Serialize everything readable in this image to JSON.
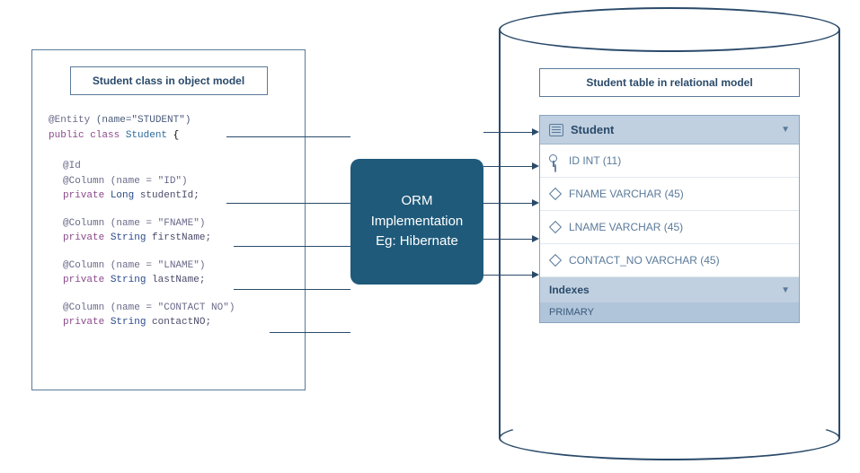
{
  "left": {
    "title": "Student class in object model",
    "code": {
      "entity_prefix": "@Entity ",
      "entity_name": "(name=\"STUDENT\")",
      "public_class": "public class ",
      "class_name": "Student",
      "brace": " {",
      "id_anno": "@Id",
      "col0": "@Column (name = \"ID\")",
      "priv": "private ",
      "type_long": "Long ",
      "field0": "studentId;",
      "col1": "@Column (name = \"FNAME\")",
      "type_string": "String ",
      "field1": "firstName;",
      "col2": "@Column (name = \"LNAME\")",
      "field2": "lastName;",
      "col3": "@Column (name = \"CONTACT NO\")",
      "field3": "contactNO;"
    }
  },
  "orm": {
    "line1": "ORM",
    "line2": "Implementation",
    "line3": "Eg: Hibernate"
  },
  "right": {
    "title": "Student table in relational model",
    "table_name": "Student",
    "cols": {
      "c0": "ID INT (11)",
      "c1": "FNAME VARCHAR (45)",
      "c2": "LNAME VARCHAR (45)",
      "c3": "CONTACT_NO VARCHAR (45)"
    },
    "indexes_label": "Indexes",
    "primary_label": "PRIMARY"
  }
}
